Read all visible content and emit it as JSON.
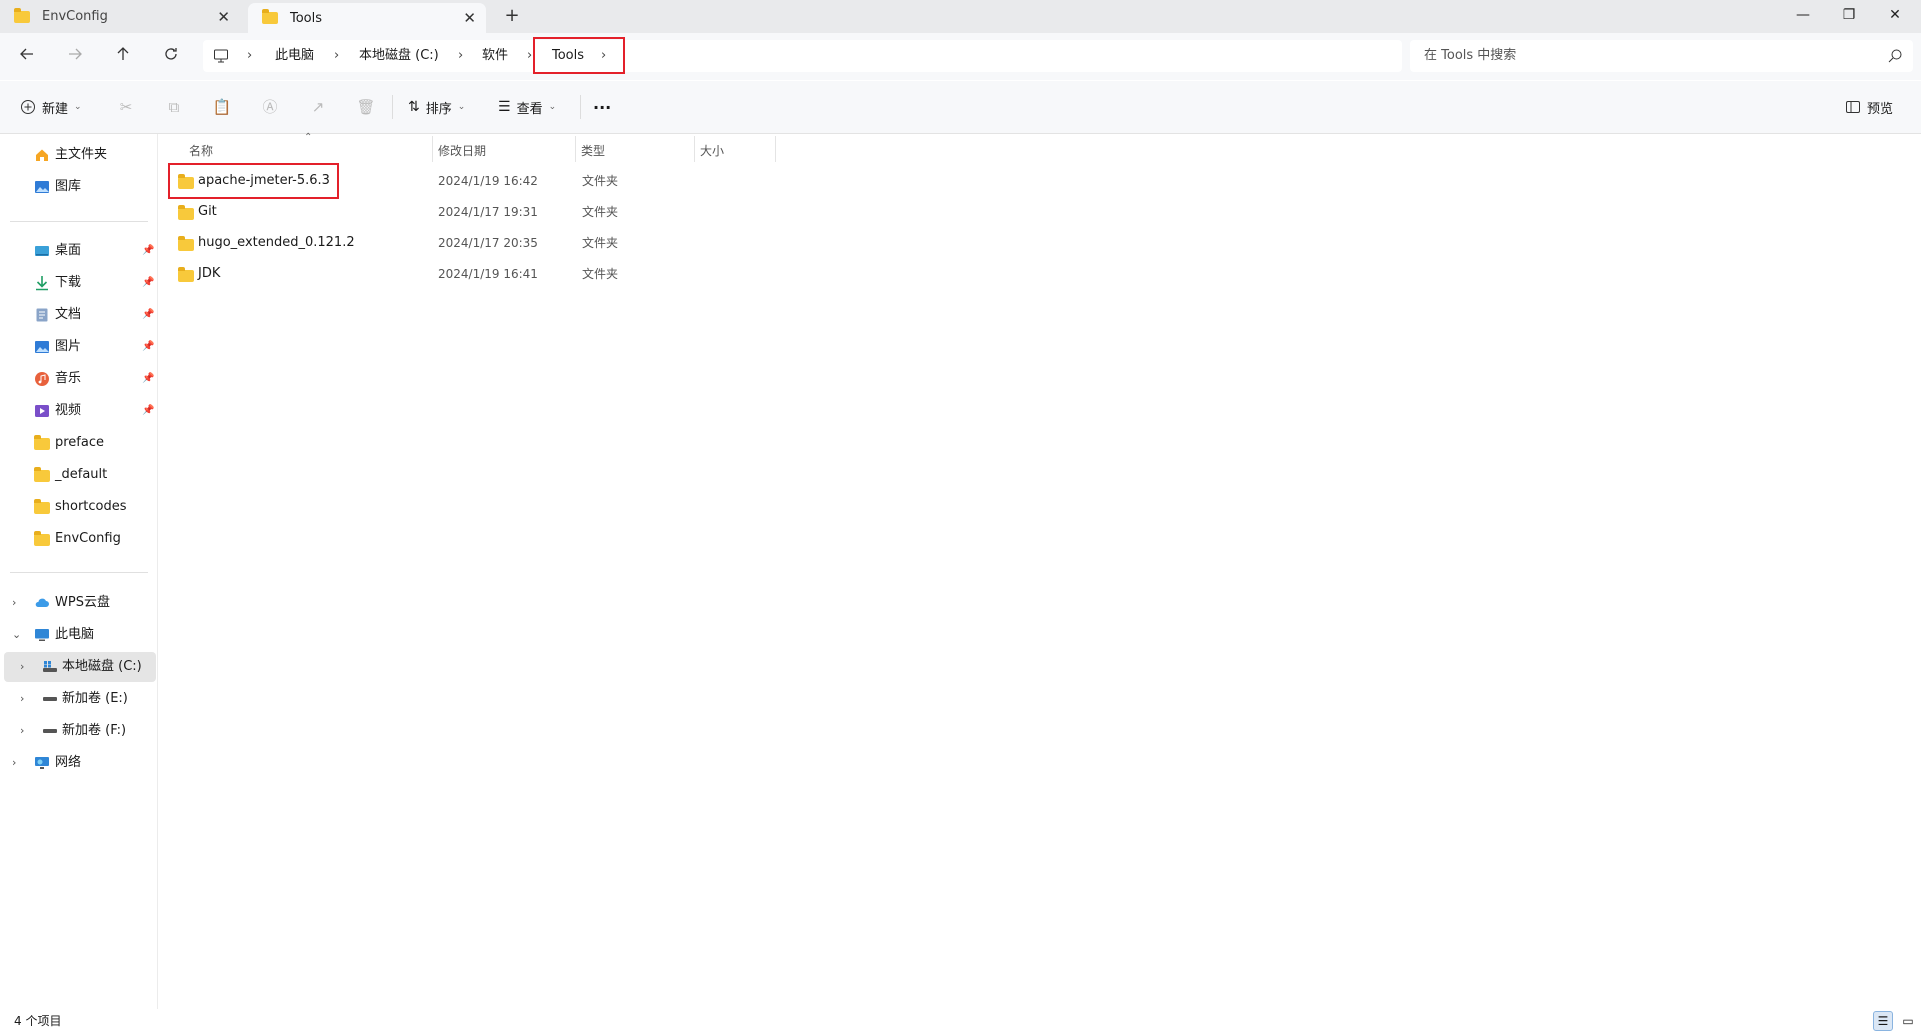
{
  "tabs": [
    {
      "label": "EnvConfig",
      "close": "✕"
    },
    {
      "label": "Tools",
      "close": "✕"
    }
  ],
  "new_tab": "+",
  "window": {
    "minimize": "—",
    "restore": "❐",
    "close": "✕"
  },
  "address": {
    "crumbs": [
      "此电脑",
      "本地磁盘 (C:)",
      "软件",
      "Tools"
    ],
    "separator": "›"
  },
  "search": {
    "placeholder": "在 Tools 中搜索"
  },
  "toolbar": {
    "new_label": "新建",
    "sort_label": "排序",
    "view_label": "查看",
    "more_label": "···",
    "preview_label": "预览"
  },
  "nav": {
    "quick": [
      {
        "label": "主文件夹",
        "icon": "home-icon"
      },
      {
        "label": "图库",
        "icon": "gallery-icon"
      }
    ],
    "pinned": [
      {
        "label": "桌面",
        "icon": "desktop-icon",
        "pin": "📌"
      },
      {
        "label": "下载",
        "icon": "download-icon",
        "pin": "📌"
      },
      {
        "label": "文档",
        "icon": "document-icon",
        "pin": "📌"
      },
      {
        "label": "图片",
        "icon": "pictures-icon",
        "pin": "📌"
      },
      {
        "label": "音乐",
        "icon": "music-icon",
        "pin": "📌"
      },
      {
        "label": "视频",
        "icon": "video-icon",
        "pin": "📌"
      }
    ],
    "folders": [
      "preface",
      "_default",
      "shortcodes",
      "EnvConfig"
    ],
    "tree": [
      {
        "label": "WPS云盘",
        "icon": "cloud-icon",
        "chevron": "›"
      },
      {
        "label": "此电脑",
        "icon": "computer-icon",
        "chevron": "⌄"
      },
      {
        "label": "本地磁盘 (C:)",
        "icon": "drive-c-icon",
        "chevron": "›"
      },
      {
        "label": "新加卷 (E:)",
        "icon": "drive-icon",
        "chevron": "›"
      },
      {
        "label": "新加卷 (F:)",
        "icon": "drive-icon",
        "chevron": "›"
      },
      {
        "label": "网络",
        "icon": "network-icon",
        "chevron": "›"
      }
    ]
  },
  "columns": {
    "name": "名称",
    "modified": "修改日期",
    "type": "类型",
    "size": "大小"
  },
  "files": [
    {
      "name": "apache-jmeter-5.6.3",
      "modified": "2024/1/19 16:42",
      "type": "文件夹"
    },
    {
      "name": "Git",
      "modified": "2024/1/17 19:31",
      "type": "文件夹"
    },
    {
      "name": "hugo_extended_0.121.2",
      "modified": "2024/1/17 20:35",
      "type": "文件夹"
    },
    {
      "name": "JDK",
      "modified": "2024/1/19 16:41",
      "type": "文件夹"
    }
  ],
  "status": {
    "count": "4 个项目"
  },
  "colors": {
    "highlight": "#e3202a",
    "selected_nav": "#e5e5e5",
    "folder": "#f8c93b"
  }
}
